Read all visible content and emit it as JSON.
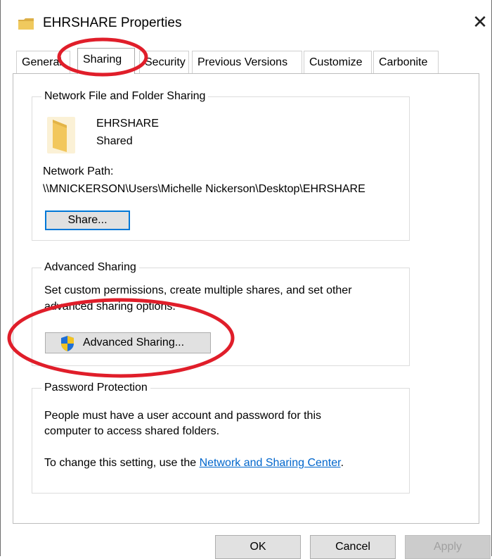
{
  "window": {
    "title": "EHRSHARE Properties",
    "close_glyph": "✕"
  },
  "tabs": [
    {
      "label": "General"
    },
    {
      "label": "Sharing",
      "active": true
    },
    {
      "label": "Security"
    },
    {
      "label": "Previous Versions"
    },
    {
      "label": "Customize"
    },
    {
      "label": "Carbonite"
    }
  ],
  "network_sharing": {
    "legend": "Network File and Folder Sharing",
    "folder_name": "EHRSHARE",
    "folder_status": "Shared",
    "path_label": "Network Path:",
    "path_value": "\\\\MNICKERSON\\Users\\Michelle Nickerson\\Desktop\\EHRSHARE",
    "share_button": "Share..."
  },
  "advanced_sharing": {
    "legend": "Advanced Sharing",
    "description_line1": "Set custom permissions, create multiple shares, and set other",
    "description_line2": "advanced sharing options.",
    "button": "Advanced Sharing..."
  },
  "password_protection": {
    "legend": "Password Protection",
    "line1": "People must have a user account and password for this",
    "line2": "computer to access shared folders.",
    "change_prefix": "To change this setting, use the ",
    "link_text": "Network and Sharing Center",
    "change_suffix": "."
  },
  "footer": {
    "ok": "OK",
    "cancel": "Cancel",
    "apply": "Apply"
  },
  "colors": {
    "highlight_ellipse": "#e01e2a",
    "link": "#0066cc",
    "folder": "#e8c15a",
    "default_button_border": "#0078d7"
  },
  "icons": {
    "title": "folder-icon",
    "folder": "folder-icon",
    "shield": "uac-shield-icon"
  }
}
